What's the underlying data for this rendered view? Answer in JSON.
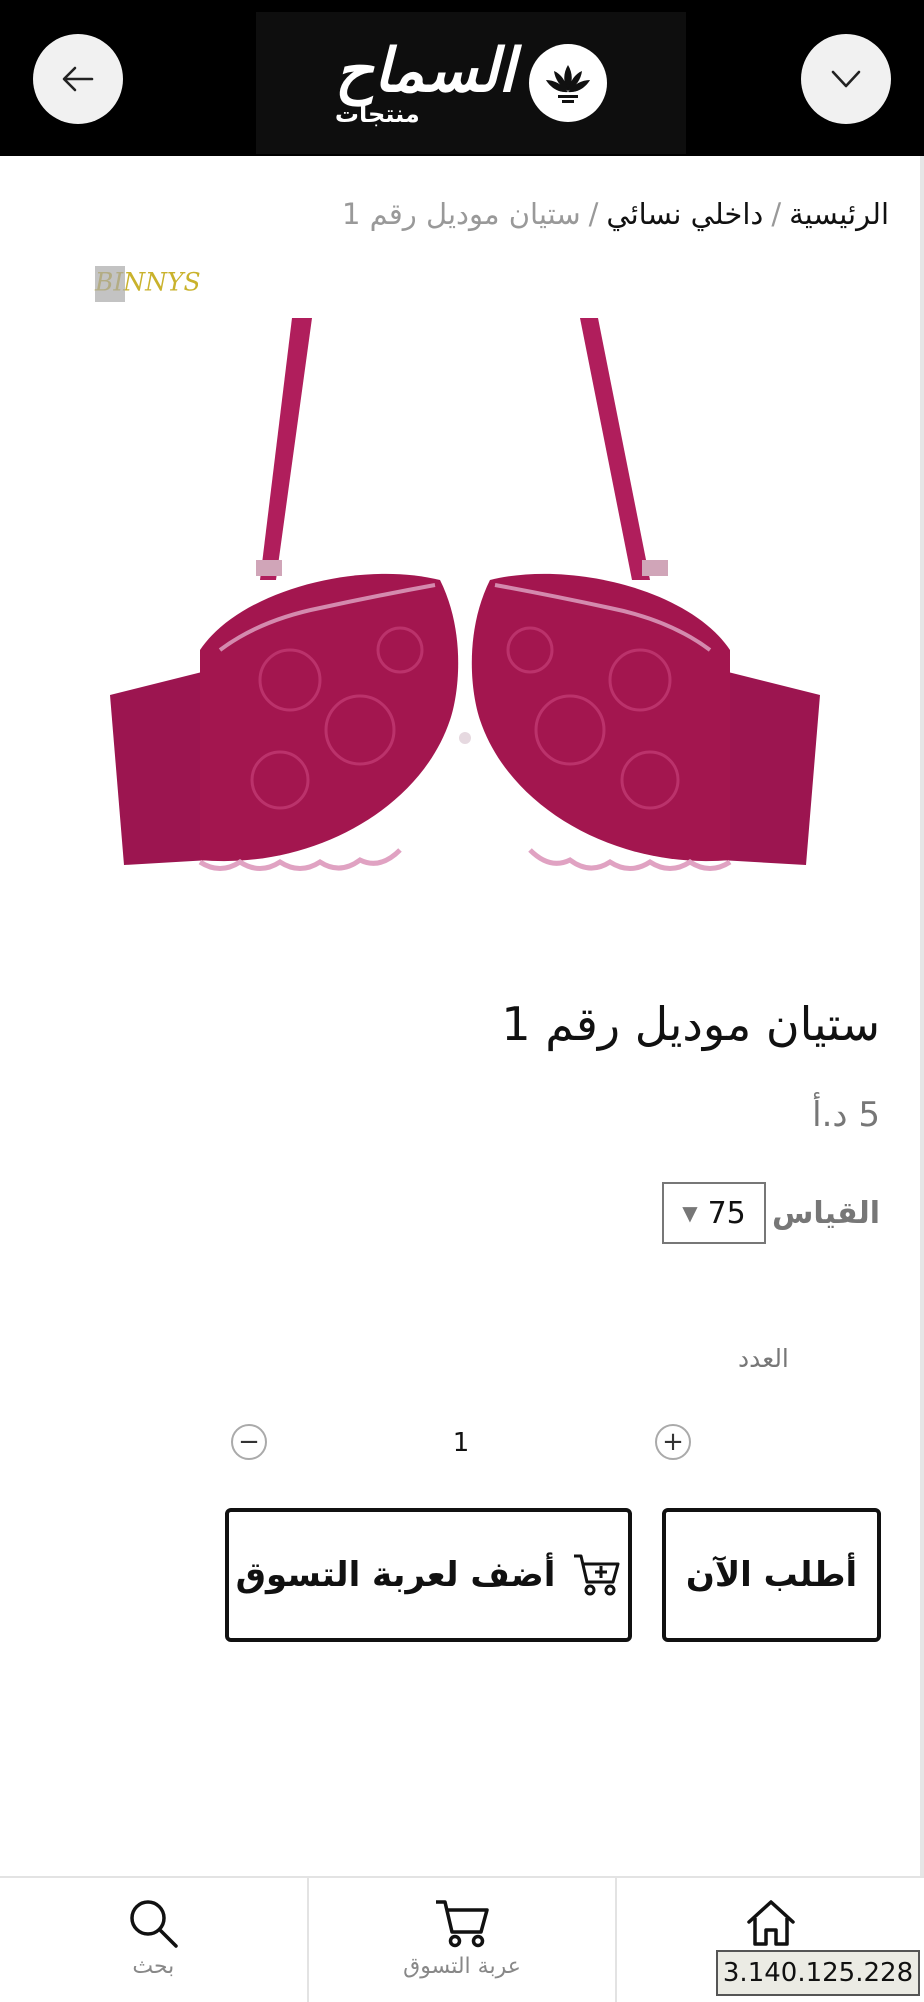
{
  "header": {
    "logo_main": "السماح",
    "logo_sub": "منتجات"
  },
  "breadcrumb": {
    "home": "الرئيسية",
    "separator": "/",
    "category": "داخلي نسائي",
    "current": "ستيان موديل رقم 1"
  },
  "product": {
    "brand_mark": "BINNYS",
    "title": "ستيان موديل رقم 1",
    "price": "5 د.أ",
    "color": "#a3164f"
  },
  "size": {
    "label": "القياس :",
    "selected": "75"
  },
  "quantity": {
    "label": "العدد",
    "value": "1",
    "minus": "−",
    "plus": "+"
  },
  "actions": {
    "add_to_cart": "أضف لعربة التسوق",
    "order_now": "أطلب الآن"
  },
  "bottom_nav": {
    "search": "بحث",
    "cart": "عربة التسوق",
    "home": ""
  },
  "overlay": {
    "ip": "3.140.125.228"
  },
  "icons": {
    "back": "arrow-left-icon",
    "menu": "chevron-down-icon",
    "cart": "cart-icon",
    "search": "search-icon",
    "home": "home-icon"
  }
}
